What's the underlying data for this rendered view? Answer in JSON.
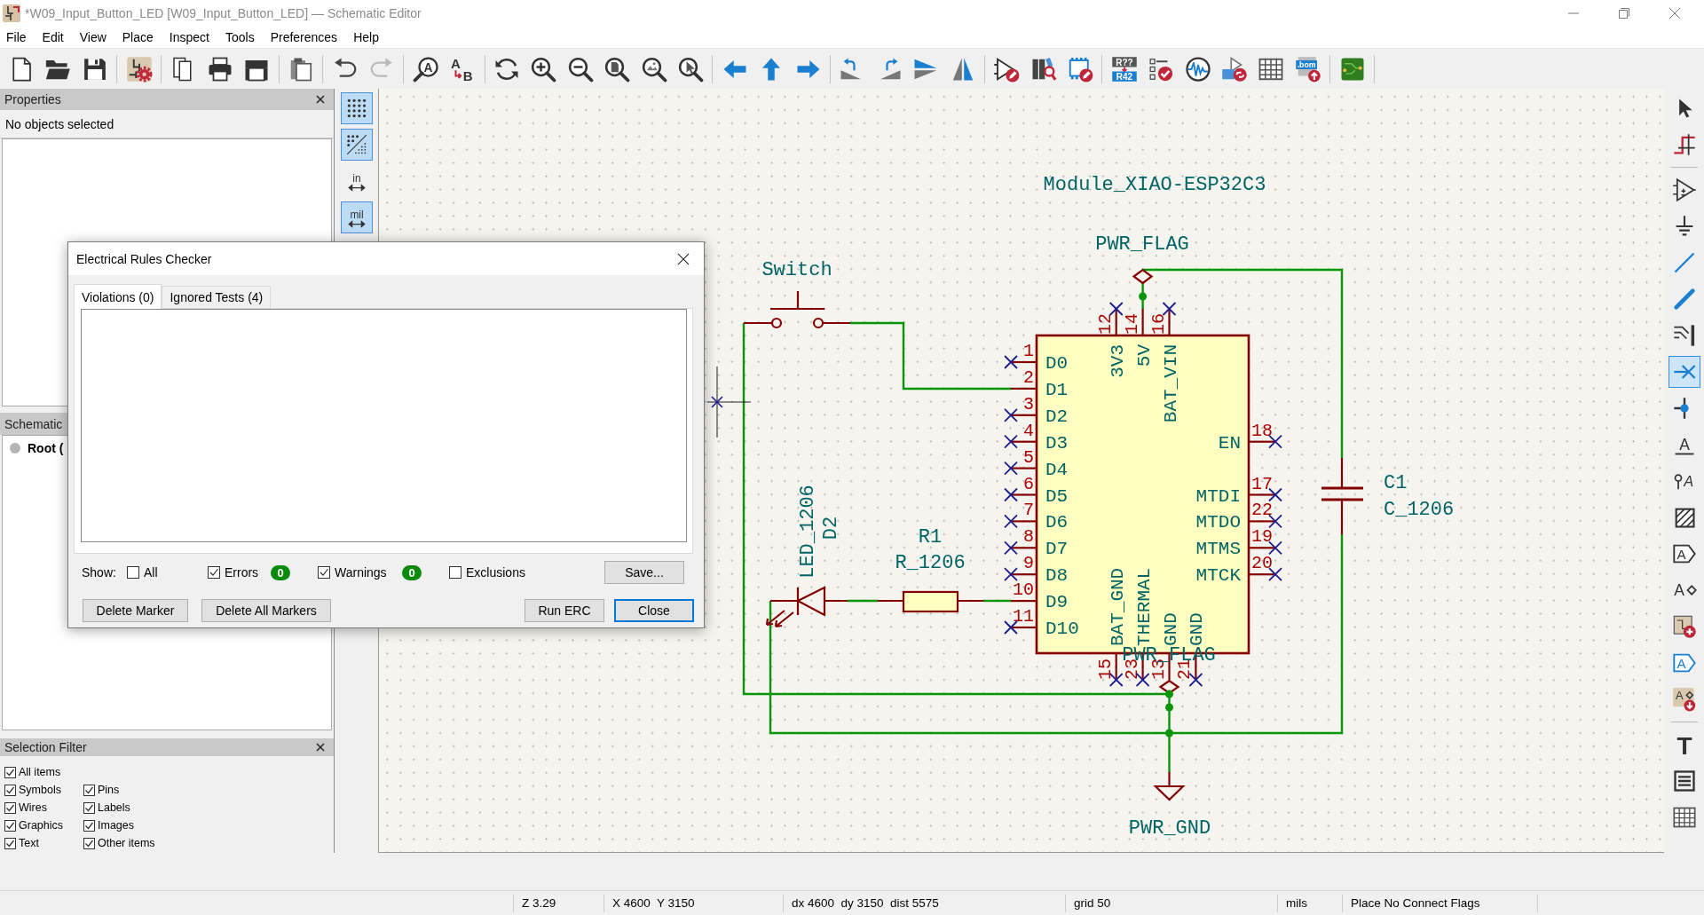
{
  "window": {
    "title": "*W09_Input_Button_LED [W09_Input_Button_LED] — Schematic Editor"
  },
  "menu": [
    "File",
    "Edit",
    "View",
    "Place",
    "Inspect",
    "Tools",
    "Preferences",
    "Help"
  ],
  "top_toolbar": {
    "find_icon_text": "A",
    "replace_icon_text": [
      "A",
      "B"
    ],
    "annotate_icon_text": [
      "R??",
      "R42"
    ],
    "bom_icon_text": ".bom"
  },
  "properties_panel": {
    "title": "Properties",
    "message": "No objects selected"
  },
  "hierarchy_panel": {
    "title": "Schematic",
    "items": [
      {
        "label": "Root ("
      }
    ]
  },
  "selection_filter": {
    "title": "Selection Filter",
    "all_items": {
      "label": "All items",
      "checked": true
    },
    "items": [
      {
        "label": "Symbols",
        "checked": true
      },
      {
        "label": "Pins",
        "checked": true
      },
      {
        "label": "Wires",
        "checked": true
      },
      {
        "label": "Labels",
        "checked": true
      },
      {
        "label": "Graphics",
        "checked": true
      },
      {
        "label": "Images",
        "checked": true
      },
      {
        "label": "Text",
        "checked": true
      },
      {
        "label": "Other items",
        "checked": true
      }
    ]
  },
  "left_toolbar": [
    {
      "selected": true
    },
    {
      "selected": true
    },
    {
      "label": "in",
      "selected": false
    },
    {
      "label": "mil",
      "selected": true
    }
  ],
  "schematic": {
    "module": {
      "value": "Module_XIAO-ESP32C3",
      "left_pins": [
        {
          "number": "1",
          "name": "D0",
          "connected": false
        },
        {
          "number": "2",
          "name": "D1",
          "connected": true
        },
        {
          "number": "3",
          "name": "D2",
          "connected": false
        },
        {
          "number": "4",
          "name": "D3",
          "connected": false
        },
        {
          "number": "5",
          "name": "D4",
          "connected": false
        },
        {
          "number": "6",
          "name": "D5",
          "connected": false
        },
        {
          "number": "7",
          "name": "D6",
          "connected": false
        },
        {
          "number": "8",
          "name": "D7",
          "connected": false
        },
        {
          "number": "9",
          "name": "D8",
          "connected": false
        },
        {
          "number": "10",
          "name": "D9",
          "connected": true
        },
        {
          "number": "11",
          "name": "D10",
          "connected": false
        }
      ],
      "right_pins": [
        {
          "number": "18",
          "name": "EN",
          "connected": false
        },
        {
          "number": "17",
          "name": "MTDI",
          "connected": false
        },
        {
          "number": "22",
          "name": "MTDO",
          "connected": false
        },
        {
          "number": "19",
          "name": "MTMS",
          "connected": false
        },
        {
          "number": "20",
          "name": "MTCK",
          "connected": false
        }
      ],
      "top_pins": [
        {
          "number": "12",
          "name": "3V3",
          "connected": false
        },
        {
          "number": "14",
          "name": "5V",
          "connected": true
        },
        {
          "number": "16",
          "name": "BAT_VIN",
          "connected": false
        }
      ],
      "bottom_pins": [
        {
          "number": "15",
          "name": "BAT_GND",
          "connected": false
        },
        {
          "number": "23",
          "name": "THERMAL",
          "connected": false
        },
        {
          "number": "13",
          "name": "GND",
          "connected": true
        },
        {
          "number": "21",
          "name": "GND",
          "connected": false
        }
      ]
    },
    "power_flags": [
      {
        "value": "PWR_FLAG"
      },
      {
        "value": "PWR_FLAG"
      }
    ],
    "switch": {
      "value": "Switch"
    },
    "led": {
      "reference": "D2",
      "value": "LED_1206"
    },
    "resistor": {
      "reference": "R1",
      "value": "R_1206"
    },
    "capacitor": {
      "reference": "C1",
      "value": "C_1206"
    },
    "ground": {
      "value": "PWR_GND"
    }
  },
  "right_toolbar": [
    {
      "selected": false
    },
    {
      "selected": false
    },
    {
      "selected": false
    },
    {
      "selected": false
    },
    {
      "selected": false
    },
    {
      "selected": false
    },
    {
      "selected": false
    },
    {
      "selected": true
    },
    {
      "selected": false
    },
    {
      "text": "A",
      "selected": false
    },
    {
      "text": "A",
      "selected": false
    },
    {
      "selected": false
    },
    {
      "text": "A",
      "selected": false
    },
    {
      "text": "A",
      "selected": false
    },
    {
      "selected": false
    },
    {
      "text": "A",
      "selected": false
    },
    {
      "text": "A",
      "selected": false
    },
    {
      "text": "T",
      "selected": false
    },
    {
      "selected": false
    },
    {
      "selected": false
    }
  ],
  "status_bar": {
    "zoom": "Z 3.29",
    "position": "X 4600  Y 3150",
    "delta": "dx 4600  dy 3150  dist 5575",
    "grid": "grid 50",
    "units": "mils",
    "message": "Place No Connect Flags"
  },
  "erc_dialog": {
    "title": "Electrical Rules Checker",
    "tabs": [
      {
        "label": "Violations (0)",
        "selected": true
      },
      {
        "label": "Ignored Tests (4)",
        "selected": false
      }
    ],
    "show_label": "Show:",
    "filters": [
      {
        "label": "All",
        "checked": false
      },
      {
        "label": "Errors",
        "checked": true,
        "count": "0"
      },
      {
        "label": "Warnings",
        "checked": true,
        "count": "0"
      },
      {
        "label": "Exclusions",
        "checked": false
      }
    ],
    "save_button": "Save...",
    "buttons_left": [
      "Delete Marker",
      "Delete All Markers"
    ],
    "buttons_right": [
      {
        "label": "Run ERC",
        "default": false
      },
      {
        "label": "Close",
        "default": true
      }
    ]
  }
}
